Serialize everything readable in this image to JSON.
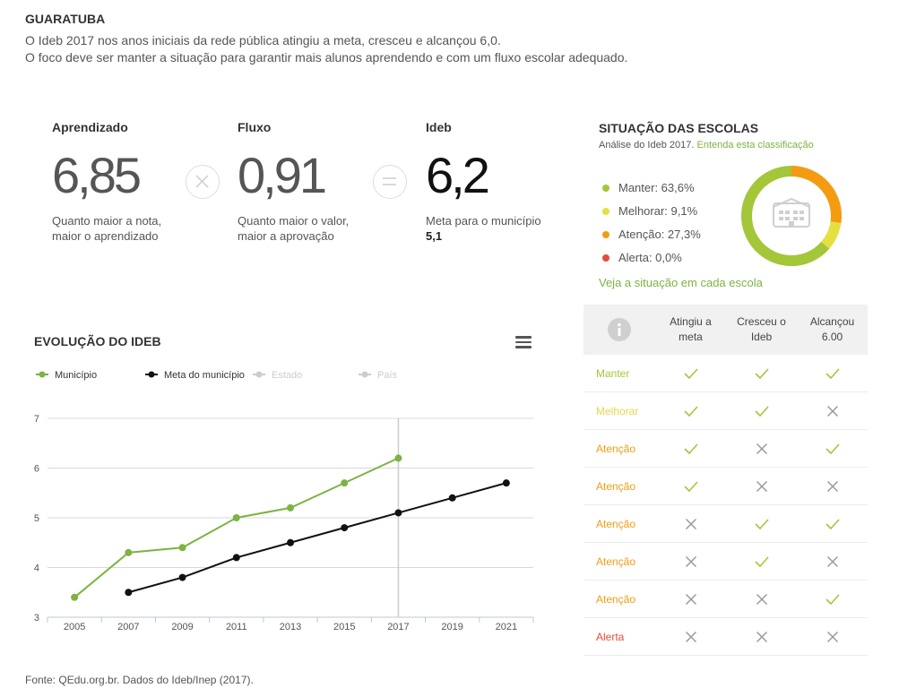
{
  "header": {
    "city": "GUARATUBA",
    "line1": "O Ideb 2017 nos anos iniciais da rede pública atingiu a meta, cresceu e alcançou 6,0.",
    "line2": "O foco deve ser manter a situação para garantir mais alunos aprendendo e com um fluxo escolar adequado."
  },
  "metrics": {
    "aprendizado": {
      "label": "Aprendizado",
      "value": "6,85",
      "note1": "Quanto maior a nota,",
      "note2": "maior o aprendizado"
    },
    "fluxo": {
      "label": "Fluxo",
      "value": "0,91",
      "note1": "Quanto maior o valor,",
      "note2": "maior a aprovação"
    },
    "ideb": {
      "label": "Ideb",
      "value": "6,2",
      "note1": "Meta para o município",
      "note2": "5,1"
    },
    "times_icon": "times-circle-icon",
    "equals_icon": "equals-circle-icon"
  },
  "situacao": {
    "title": "SITUAÇÃO DAS ESCOLAS",
    "subtitle": "Análise do Ideb 2017.",
    "link": "Entenda esta classificação",
    "legend": [
      {
        "label": "Manter: 63,6%",
        "color": "#a4c639",
        "value": 63.6
      },
      {
        "label": "Melhorar: 9,1%",
        "color": "#e6df42",
        "value": 9.1
      },
      {
        "label": "Atenção: 27,3%",
        "color": "#f39c12",
        "value": 27.3
      },
      {
        "label": "Alerta: 0,0%",
        "color": "#e74c3c",
        "value": 0.0
      }
    ],
    "see_all": "Veja a situação em cada escola",
    "center_icon": "school-building-icon"
  },
  "table": {
    "info_icon": "info-icon",
    "columns": [
      {
        "l1": "Atingiu a",
        "l2": "meta"
      },
      {
        "l1": "Cresceu o",
        "l2": "Ideb"
      },
      {
        "l1": "Alcançou",
        "l2": "6.00"
      }
    ],
    "rows": [
      {
        "label": "Manter",
        "color": "#a4c639",
        "marks": [
          "check",
          "check",
          "check"
        ]
      },
      {
        "label": "Melhorar",
        "color": "#e6d84a",
        "marks": [
          "check",
          "check",
          "cross"
        ]
      },
      {
        "label": "Atenção",
        "color": "#f39c12",
        "marks": [
          "check",
          "cross",
          "check"
        ]
      },
      {
        "label": "Atenção",
        "color": "#f39c12",
        "marks": [
          "check",
          "cross",
          "cross"
        ]
      },
      {
        "label": "Atenção",
        "color": "#f39c12",
        "marks": [
          "cross",
          "check",
          "check"
        ]
      },
      {
        "label": "Atenção",
        "color": "#f39c12",
        "marks": [
          "cross",
          "check",
          "cross"
        ]
      },
      {
        "label": "Atenção",
        "color": "#f39c12",
        "marks": [
          "cross",
          "cross",
          "check"
        ]
      },
      {
        "label": "Alerta",
        "color": "#e74c3c",
        "marks": [
          "cross",
          "cross",
          "cross"
        ]
      }
    ]
  },
  "chart_data": {
    "type": "line",
    "title": "EVOLUÇÃO DO IDEB",
    "menu_icon": "hamburger-menu-icon",
    "categories": [
      "2005",
      "2007",
      "2009",
      "2011",
      "2013",
      "2015",
      "2017",
      "2019",
      "2021"
    ],
    "ylim": [
      3,
      7
    ],
    "yticks": [
      "3",
      "4",
      "5",
      "6",
      "7"
    ],
    "grid": true,
    "legend_position": "top-left",
    "highlight_category": "2017",
    "series": [
      {
        "name": "Município",
        "color": "#7cb342",
        "enabled": true,
        "values": [
          3.4,
          4.3,
          4.4,
          5.0,
          5.2,
          5.7,
          6.2,
          null,
          null
        ]
      },
      {
        "name": "Meta do município",
        "color": "#111111",
        "enabled": true,
        "values": [
          null,
          3.5,
          3.8,
          4.2,
          4.5,
          4.8,
          5.1,
          5.4,
          5.7
        ]
      },
      {
        "name": "Estado",
        "color": "#cccccc",
        "enabled": false,
        "values": []
      },
      {
        "name": "País",
        "color": "#cccccc",
        "enabled": false,
        "values": []
      }
    ]
  },
  "footer": {
    "source": "Fonte: QEdu.org.br. Dados do Ideb/Inep (2017)."
  }
}
